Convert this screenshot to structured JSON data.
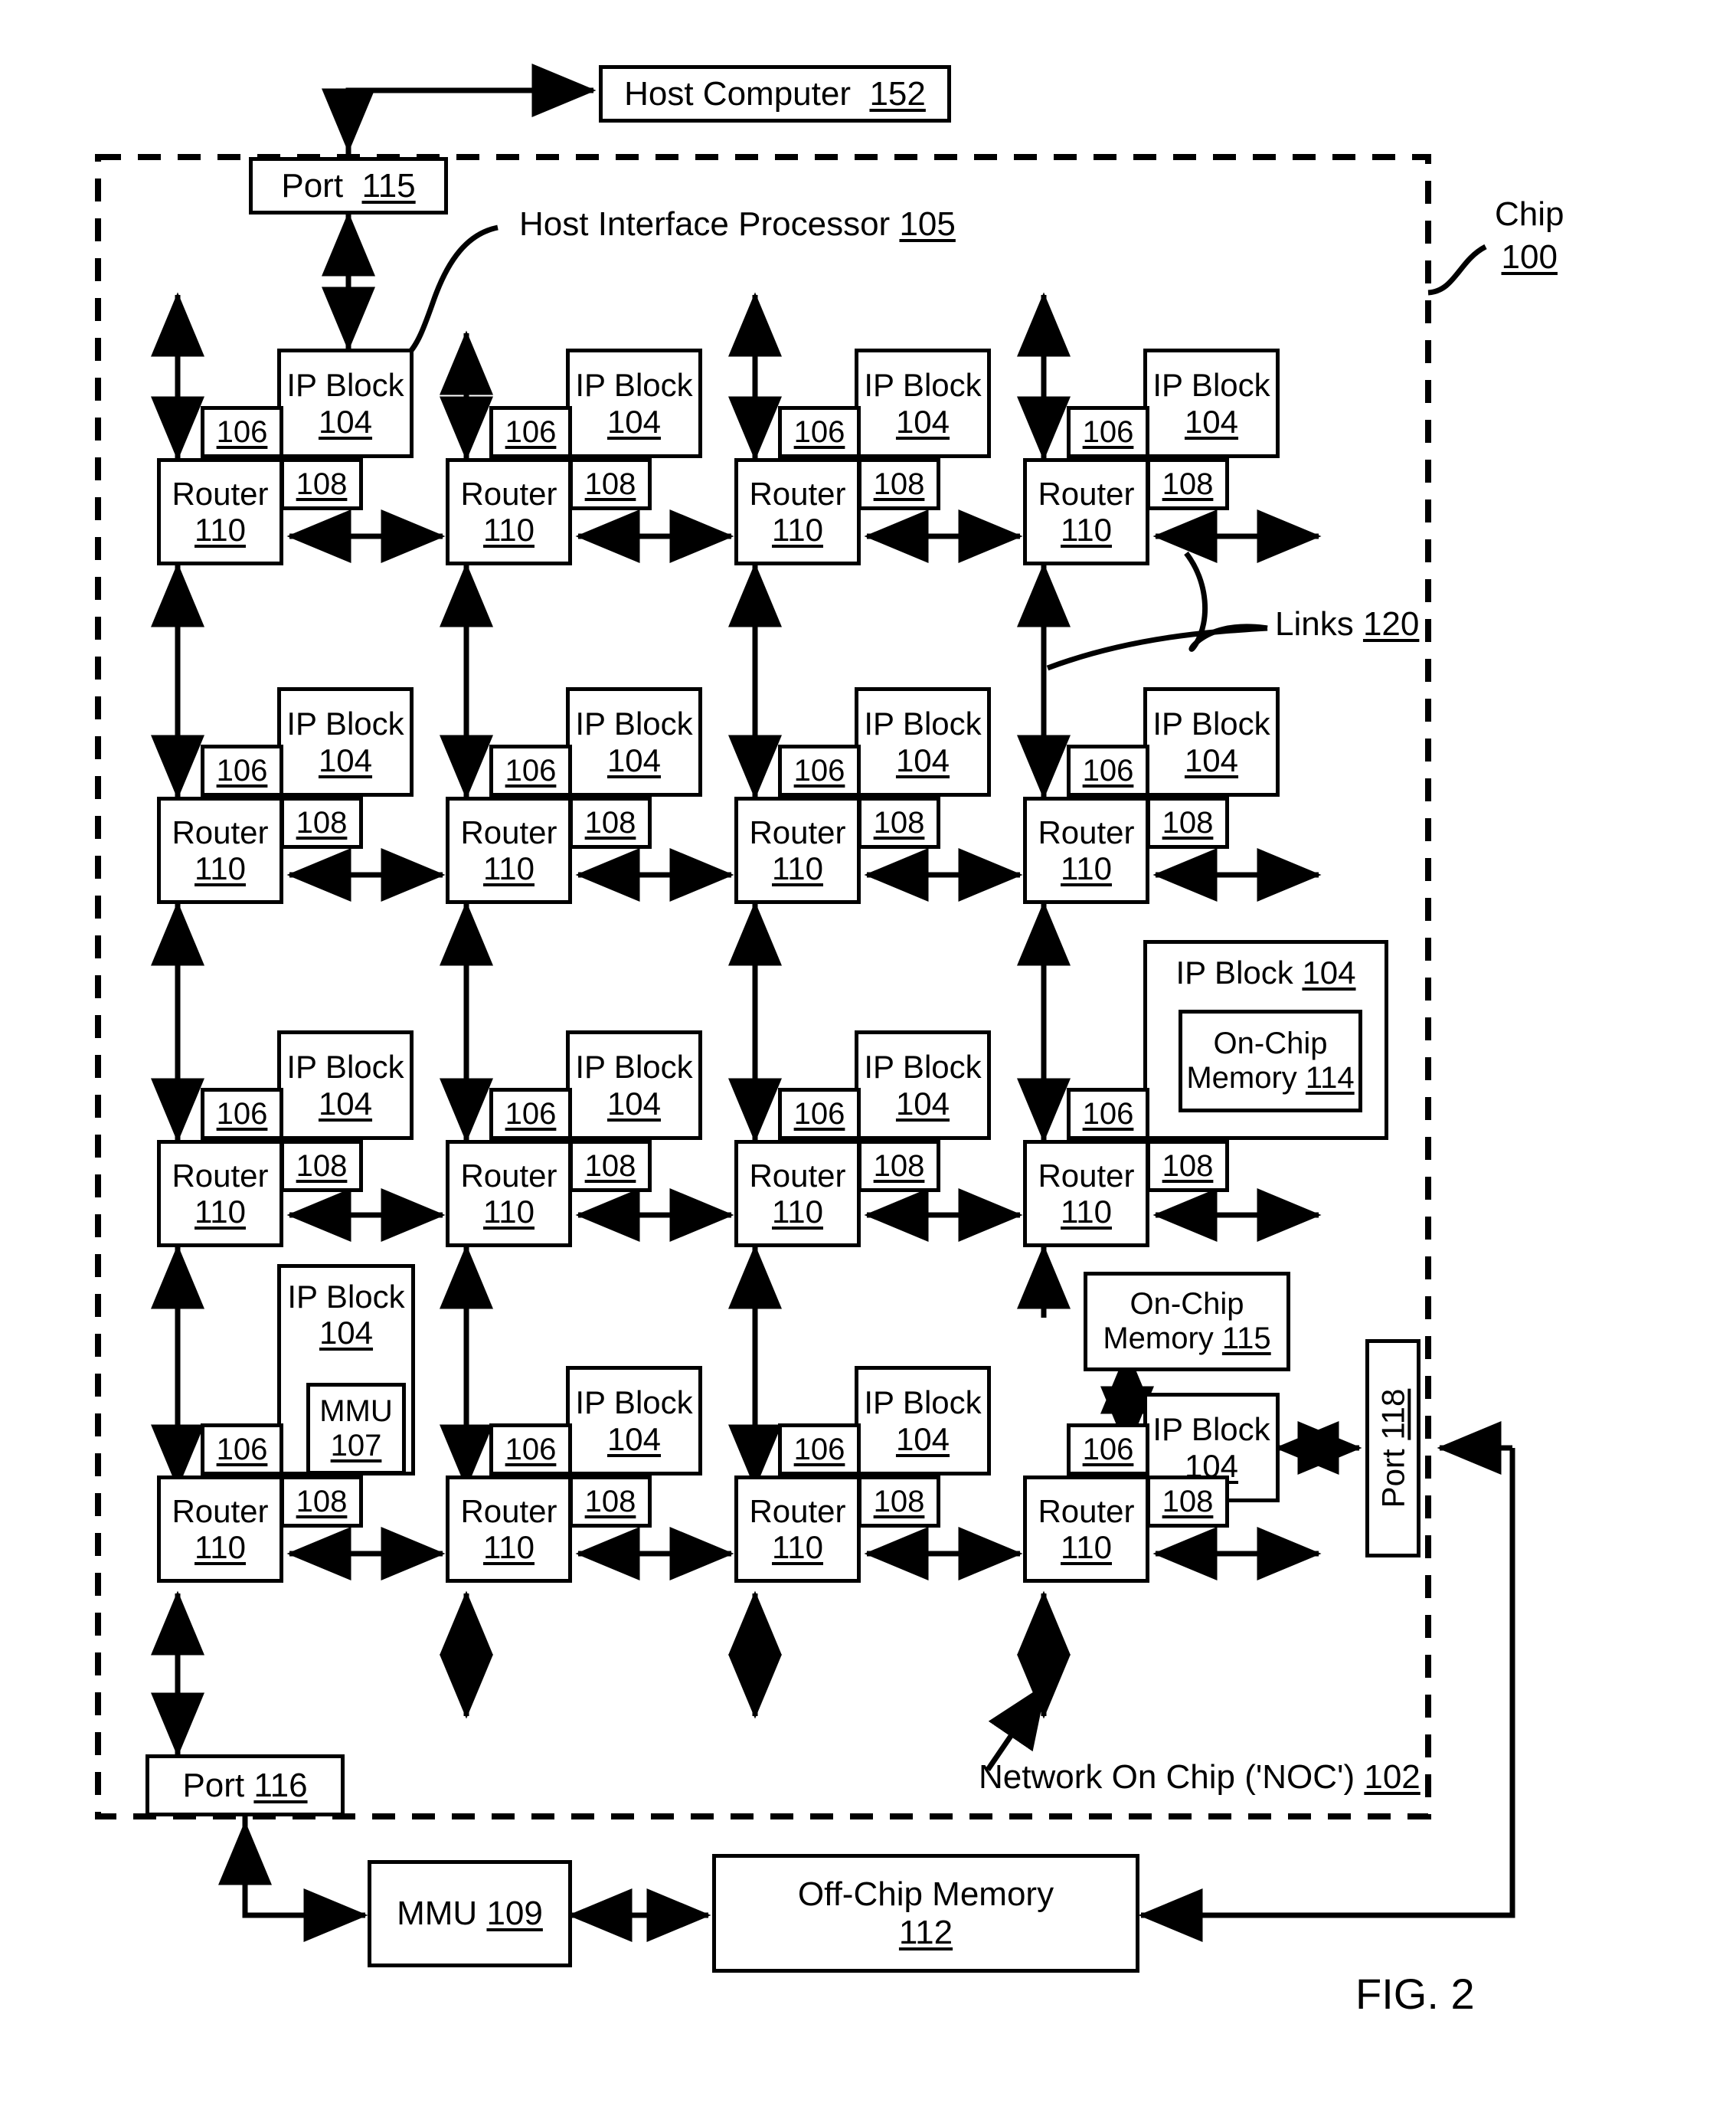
{
  "figure": {
    "label": "FIG. 2",
    "chip_label": {
      "line1": "Chip",
      "line2": "100"
    },
    "noc_label": "Network On Chip ('NOC')",
    "noc_num": "102",
    "links_label": "Links",
    "links_num": "120",
    "hip_label": "Host Interface Processor",
    "hip_num": "105"
  },
  "host_computer": {
    "label": "Host Computer",
    "num": "152"
  },
  "port_115": {
    "label": "Port",
    "num": "115"
  },
  "port_116": {
    "label": "Port",
    "num": "116"
  },
  "port_118": {
    "label": "Port",
    "num": "118"
  },
  "mmu_109": {
    "label": "MMU",
    "num": "109"
  },
  "off_chip_memory": {
    "label": "Off-Chip Memory",
    "num": "112"
  },
  "on_chip_memory_114": {
    "label_line1": "On-Chip",
    "label_line2": "Memory",
    "num": "114"
  },
  "on_chip_memory_115": {
    "label_line1": "On-Chip",
    "label_line2": "Memory",
    "num": "115"
  },
  "mmu_107": {
    "label": "MMU",
    "num": "107"
  },
  "common": {
    "ip_block_label": "IP Block",
    "ip_block_num": "104",
    "router_label": "Router",
    "router_num": "110",
    "mem_comm_num": "106",
    "net_iface_num": "108"
  },
  "grid": {
    "rows": 4,
    "cols": 4,
    "cells": [
      [
        {
          "id": "r1c1",
          "ip": "IP Block",
          "ip_num": "104",
          "router": "Router",
          "router_num": "110",
          "n106": "106",
          "n108": "108"
        },
        {
          "id": "r1c2",
          "ip": "IP Block",
          "ip_num": "104",
          "router": "Router",
          "router_num": "110",
          "n106": "106",
          "n108": "108"
        },
        {
          "id": "r1c3",
          "ip": "IP Block",
          "ip_num": "104",
          "router": "Router",
          "router_num": "110",
          "n106": "106",
          "n108": "108"
        },
        {
          "id": "r1c4",
          "ip": "IP Block",
          "ip_num": "104",
          "router": "Router",
          "router_num": "110",
          "n106": "106",
          "n108": "108"
        }
      ],
      [
        {
          "id": "r2c1",
          "ip": "IP Block",
          "ip_num": "104",
          "router": "Router",
          "router_num": "110",
          "n106": "106",
          "n108": "108"
        },
        {
          "id": "r2c2",
          "ip": "IP Block",
          "ip_num": "104",
          "router": "Router",
          "router_num": "110",
          "n106": "106",
          "n108": "108"
        },
        {
          "id": "r2c3",
          "ip": "IP Block",
          "ip_num": "104",
          "router": "Router",
          "router_num": "110",
          "n106": "106",
          "n108": "108"
        },
        {
          "id": "r2c4",
          "ip": "IP Block",
          "ip_num": "104",
          "router": "Router",
          "router_num": "110",
          "n106": "106",
          "n108": "108"
        }
      ],
      [
        {
          "id": "r3c1",
          "ip": "IP Block",
          "ip_num": "104",
          "router": "Router",
          "router_num": "110",
          "n106": "106",
          "n108": "108"
        },
        {
          "id": "r3c2",
          "ip": "IP Block",
          "ip_num": "104",
          "router": "Router",
          "router_num": "110",
          "n106": "106",
          "n108": "108"
        },
        {
          "id": "r3c3",
          "ip": "IP Block",
          "ip_num": "104",
          "router": "Router",
          "router_num": "110",
          "n106": "106",
          "n108": "108"
        },
        {
          "id": "r3c4",
          "ip": "IP Block",
          "ip_num": "104",
          "router": "Router",
          "router_num": "110",
          "n106": "106",
          "n108": "108",
          "contains": "On-Chip Memory 114"
        }
      ],
      [
        {
          "id": "r4c1",
          "ip": "IP Block",
          "ip_num": "104",
          "router": "Router",
          "router_num": "110",
          "n106": "106",
          "n108": "108",
          "contains": "MMU 107"
        },
        {
          "id": "r4c2",
          "ip": "IP Block",
          "ip_num": "104",
          "router": "Router",
          "router_num": "110",
          "n106": "106",
          "n108": "108"
        },
        {
          "id": "r4c3",
          "ip": "IP Block",
          "ip_num": "104",
          "router": "Router",
          "router_num": "110",
          "n106": "106",
          "n108": "108"
        },
        {
          "id": "r4c4",
          "ip": "IP Block",
          "ip_num": "104",
          "router": "Router",
          "router_num": "110",
          "n106": "106",
          "n108": "108"
        }
      ]
    ]
  },
  "colors": {
    "ink": "#000000",
    "paper": "#ffffff"
  }
}
